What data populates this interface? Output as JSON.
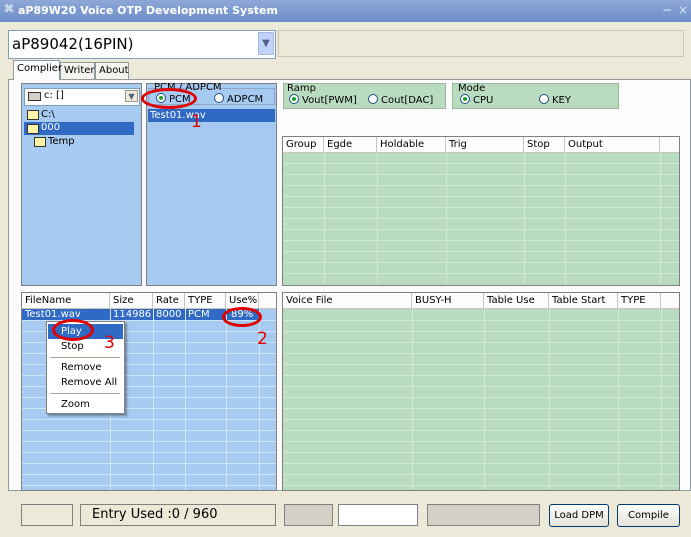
{
  "window": {
    "title": "aP89W20 Voice OTP Development System",
    "minimize_glyph": "−",
    "close_glyph": "×"
  },
  "device_select": {
    "value": "aP89042(16PIN)"
  },
  "tabs": [
    {
      "label": "Complier",
      "active": true
    },
    {
      "label": "Writer",
      "active": false
    },
    {
      "label": "About",
      "active": false
    }
  ],
  "drive_select": {
    "value": "c: []"
  },
  "folders": [
    {
      "label": "C:\\",
      "icon": "folder-open-icon"
    },
    {
      "label": "000",
      "icon": "folder-open-icon",
      "selected": true
    },
    {
      "label": "Temp",
      "icon": "folder-icon"
    }
  ],
  "pcm_group": {
    "label": "PCM / ADPCM",
    "options": [
      {
        "label": "PCM",
        "checked": true
      },
      {
        "label": "ADPCM",
        "checked": false
      }
    ]
  },
  "wave_files": [
    {
      "label": "Test01.wav",
      "selected": true
    }
  ],
  "ramp_group": {
    "label": "Ramp",
    "options": [
      {
        "label": "Vout[PWM]",
        "checked": true
      },
      {
        "label": "Cout[DAC]",
        "checked": false
      }
    ]
  },
  "mode_group": {
    "label": "Mode",
    "options": [
      {
        "label": "CPU",
        "checked": true
      },
      {
        "label": "KEY",
        "checked": false
      }
    ]
  },
  "trigger_table": {
    "columns": [
      "Group",
      "Egde",
      "Holdable",
      "Trig",
      "Stop",
      "Output"
    ]
  },
  "file_table": {
    "columns": [
      "FileName",
      "Size",
      "Rate",
      "TYPE",
      "Use%"
    ],
    "rows": [
      {
        "filename": "Test01.wav",
        "size": "114986",
        "rate": "8000",
        "type": "PCM",
        "use": "89%"
      }
    ]
  },
  "voice_table": {
    "columns": [
      "Voice File",
      "BUSY-H",
      "Table Use",
      "Table Start",
      "TYPE"
    ]
  },
  "context_menu": {
    "items": [
      "Play",
      "Stop",
      "Remove",
      "Remove All",
      "Zoom"
    ],
    "selected": "Play"
  },
  "annotations": [
    "1",
    "2",
    "3"
  ],
  "status_bar": {
    "entry_used": "Entry Used :0 / 960",
    "load_dpm": "Load DPM",
    "compile": "Compile"
  },
  "colors": {
    "file_panel": "#a6caf0",
    "table_panel": "#b9dcc0",
    "selection": "#316ac5",
    "annotation": "#e00000"
  }
}
